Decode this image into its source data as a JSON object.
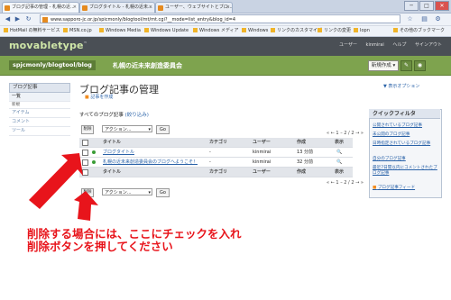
{
  "browser": {
    "tabs": [
      {
        "label": "ブログ記事の管理 - 札幌の近..."
      },
      {
        "label": "ブログタイトル - 札幌の近未..."
      },
      {
        "label": "ユーザー、ウェブサイトとブロ..."
      }
    ],
    "url": "www.sapporo-jc.or.jp/spicmonly/blogtool/mt/mt.cgi?__mode=list_entry&blog_id=4",
    "bookmarks": [
      "HotMail の無料サービス",
      "MSN.co.jp",
      "Windows Media",
      "Windows Update",
      "Windows メディア",
      "Windows",
      "リンクのカスタマイズ",
      "リンクの変更",
      "Iopn",
      "その他のブックマーク"
    ],
    "window_buttons": [
      "─",
      "□",
      "✕"
    ]
  },
  "header": {
    "logo": "movabletype",
    "logo_tm": "™",
    "user_label": "ユーザー",
    "user_name": "kinmirai",
    "help": "ヘルプ",
    "signout": "サインアウト"
  },
  "blogbar": {
    "path": "spjcmonly/blogtool/blog",
    "blog_name": "札幌の近未来創造委員会",
    "new_button": "新規作成 ▾",
    "icons": [
      "wrench-icon",
      "eye-icon"
    ]
  },
  "sidebar": {
    "section": "ブログ記事",
    "items": [
      {
        "label": "一覧",
        "selected": true
      },
      {
        "label": "新規",
        "small": true
      },
      {
        "label": "アイテム"
      },
      {
        "label": "コメント"
      },
      {
        "label": "ツール"
      }
    ]
  },
  "main": {
    "title": "ブログ記事の管理",
    "rss": "記事を作成",
    "display_options": "▼ 表示オプション",
    "list_heading": "すべてのブログ記事",
    "list_link": "(絞り込み)",
    "action_placeholder": "アクション...",
    "go_label": "Go",
    "delete_label": "削除",
    "pager": "« ← 1 – 2 / 2 → »",
    "columns": [
      "",
      "",
      "タイトル",
      "カテゴリ",
      "ユーザー",
      "作成",
      "表示"
    ],
    "rows": [
      {
        "title": "ブログタイトル",
        "category": "-",
        "user": "kinmirai",
        "created": "13 分前",
        "view": "🔍"
      },
      {
        "title": "札幌の近未来創造委員会のブログへようこそ！",
        "category": "-",
        "user": "kinmirai",
        "created": "32 分前",
        "view": "🔍"
      }
    ]
  },
  "quick_filter": {
    "title": "クイックフィルタ",
    "links": [
      "公開されているブログ記事",
      "未公開のブログ記事",
      "日時指定されているブログ記事",
      "自分のブログ記事",
      "最近7日間以内にコメントされたブログ記事",
      "ブログ記事フィード"
    ]
  },
  "annotation": {
    "line1": "削除する場合には、ここにチェックを入れ",
    "line2": "削除ボタンを押してください"
  },
  "colors": {
    "accent_green": "#7ea34e",
    "header_dark": "#4a4f55",
    "annotation_red": "#e8141b"
  }
}
